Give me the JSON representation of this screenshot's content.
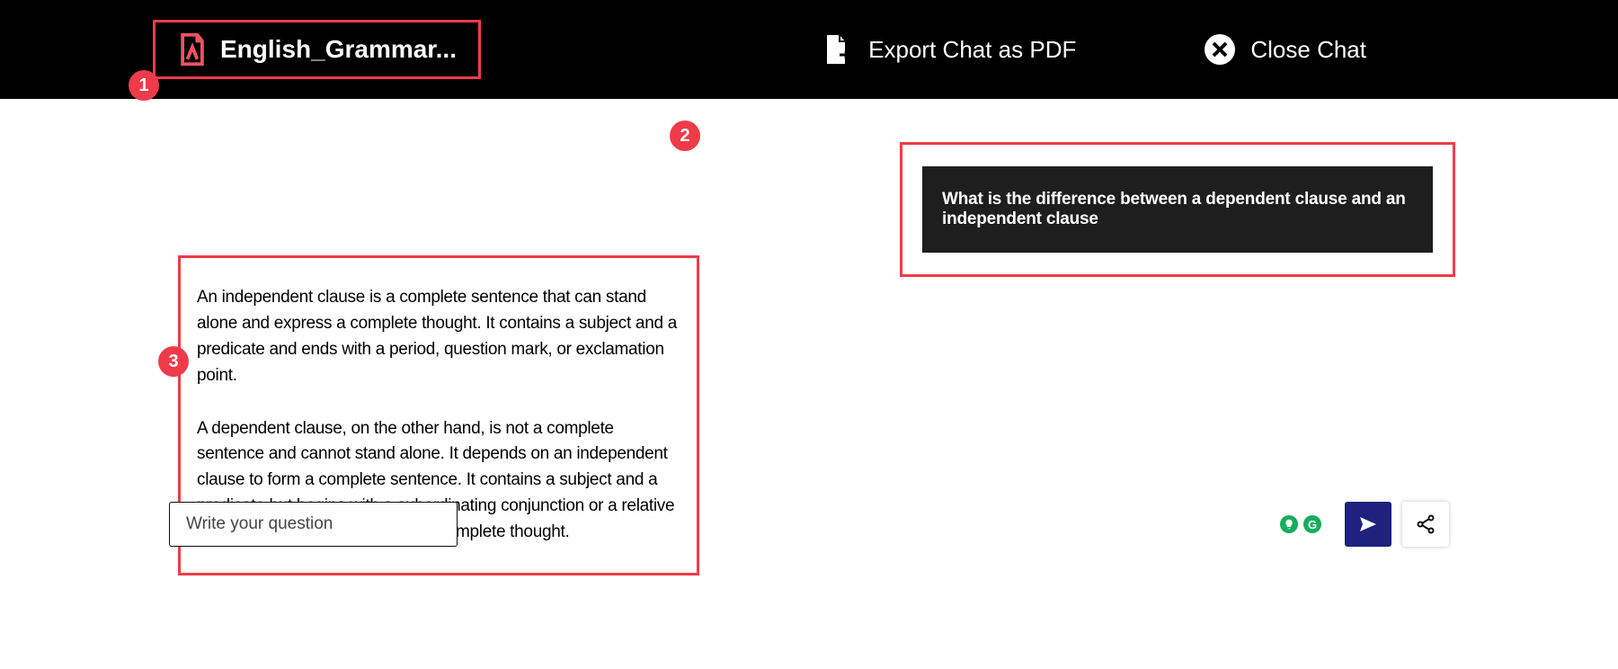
{
  "header": {
    "doc_title": "English_Grammar...",
    "export_label": "Export Chat as PDF",
    "close_label": "Close Chat"
  },
  "badges": {
    "b1": "1",
    "b2": "2",
    "b3": "3"
  },
  "chat": {
    "user_msg": "What is the difference between a dependent clause and an independent clause",
    "assistant_p1": "An independent clause is a complete sentence that can stand alone and express a complete thought. It contains a subject and a predicate and ends with a period, question mark, or exclamation point.",
    "assistant_p2": "A dependent clause, on the other hand, is not a complete sentence and cannot stand alone. It depends on an independent clause to form a complete sentence. It contains a subject and a predicate but begins with a subordinating conjunction or a relative pronoun and does not express a complete thought."
  },
  "input": {
    "placeholder": "Write your question"
  }
}
